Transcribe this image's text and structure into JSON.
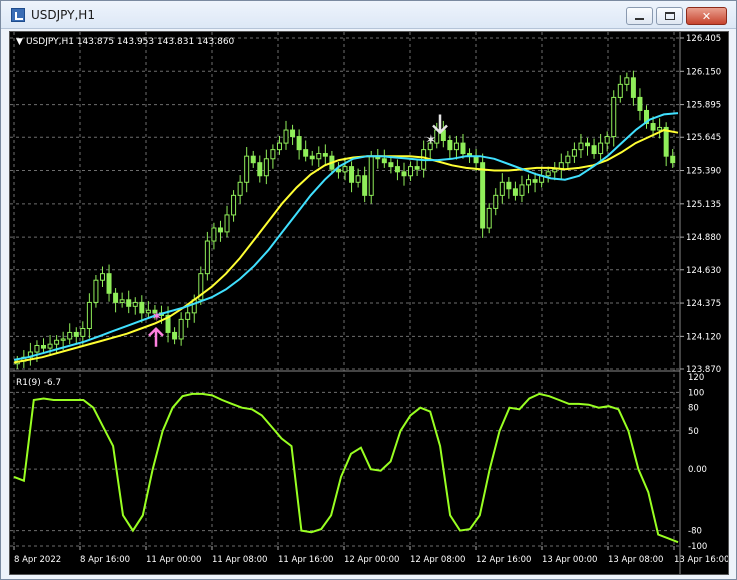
{
  "window": {
    "title": "USDJPY,H1",
    "minimize_label": "",
    "maximize_label": "",
    "close_label": "✕"
  },
  "price_panel": {
    "header": "USDJPY,H1  143.875 143.953 143.831 143.860",
    "header_arrow": "▼",
    "price_ticks": [
      "126.405",
      "126.150",
      "125.895",
      "125.645",
      "125.390",
      "125.135",
      "124.880",
      "124.630",
      "124.375",
      "124.120",
      "123.870"
    ]
  },
  "indicator_panel": {
    "label": "R1(9) -6.7",
    "ticks": [
      "120",
      "100",
      "80",
      "50",
      "0.00",
      "-80",
      "-100"
    ]
  },
  "time_axis": [
    "8 Apr 2022",
    "8 Apr 16:00",
    "11 Apr 00:00",
    "11 Apr 08:00",
    "11 Apr 16:00",
    "12 Apr 00:00",
    "12 Apr 08:00",
    "12 Apr 16:00",
    "13 Apr 00:00",
    "13 Apr 08:00",
    "13 Apr 16:00"
  ],
  "colors": {
    "background": "#000000",
    "grid": "#6e6e6e",
    "candle": "#90ee5a",
    "ma_fast": "#40e0ff",
    "ma_slow": "#ffff33",
    "oscillator": "#99ff22",
    "buy_arrow": "#ff80e0",
    "sell_arrow": "#e6e6e6"
  },
  "chart_data": {
    "type": "line",
    "symbol": "USDJPY",
    "timeframe": "H1",
    "ylim": [
      123.87,
      126.405
    ],
    "candles_close": [
      123.93,
      123.96,
      124.0,
      124.05,
      124.03,
      124.06,
      124.09,
      124.1,
      124.15,
      124.12,
      124.18,
      124.38,
      124.55,
      124.6,
      124.45,
      124.38,
      124.4,
      124.35,
      124.38,
      124.3,
      124.32,
      124.3,
      124.28,
      124.15,
      124.1,
      124.25,
      124.3,
      124.4,
      124.6,
      124.85,
      124.95,
      124.92,
      125.05,
      125.2,
      125.3,
      125.5,
      125.45,
      125.35,
      125.48,
      125.55,
      125.6,
      125.7,
      125.65,
      125.55,
      125.5,
      125.48,
      125.52,
      125.5,
      125.4,
      125.38,
      125.42,
      125.3,
      125.35,
      125.2,
      125.5,
      125.48,
      125.45,
      125.42,
      125.38,
      125.35,
      125.42,
      125.4,
      125.55,
      125.6,
      125.7,
      125.62,
      125.55,
      125.6,
      125.52,
      125.5,
      125.45,
      124.95,
      125.1,
      125.2,
      125.3,
      125.25,
      125.2,
      125.28,
      125.32,
      125.3,
      125.35,
      125.38,
      125.4,
      125.45,
      125.5,
      125.55,
      125.6,
      125.58,
      125.52,
      125.6,
      125.65,
      125.95,
      126.05,
      126.1,
      125.95,
      125.85,
      125.75,
      125.7,
      125.72,
      125.5,
      125.45
    ],
    "ma_fast": [
      123.94,
      123.96,
      123.99,
      124.02,
      124.05,
      124.08,
      124.12,
      124.16,
      124.2,
      124.24,
      124.28,
      124.31,
      124.34,
      124.38,
      124.42,
      124.48,
      124.56,
      124.66,
      124.78,
      124.92,
      125.06,
      125.2,
      125.32,
      125.42,
      125.48,
      125.5,
      125.5,
      125.49,
      125.48,
      125.47,
      125.47,
      125.48,
      125.5,
      125.5,
      125.48,
      125.44,
      125.4,
      125.36,
      125.33,
      125.32,
      125.35,
      125.42,
      125.5,
      125.6,
      125.7,
      125.78,
      125.82,
      125.83
    ],
    "ma_slow": [
      123.92,
      123.94,
      123.96,
      123.99,
      124.02,
      124.05,
      124.08,
      124.11,
      124.14,
      124.18,
      124.22,
      124.27,
      124.34,
      124.42,
      124.5,
      124.6,
      124.72,
      124.86,
      125.0,
      125.14,
      125.26,
      125.36,
      125.43,
      125.47,
      125.49,
      125.5,
      125.5,
      125.5,
      125.5,
      125.49,
      125.46,
      125.43,
      125.41,
      125.4,
      125.39,
      125.39,
      125.4,
      125.41,
      125.41,
      125.4,
      125.41,
      125.43,
      125.47,
      125.53,
      125.6,
      125.65,
      125.7,
      125.68
    ],
    "oscillator": [
      -10,
      -15,
      90,
      92,
      90,
      90,
      90,
      90,
      80,
      55,
      30,
      -60,
      -80,
      -60,
      0,
      50,
      80,
      95,
      98,
      98,
      96,
      90,
      85,
      80,
      78,
      70,
      55,
      40,
      30,
      -80,
      -82,
      -78,
      -60,
      -10,
      20,
      28,
      0,
      -2,
      10,
      50,
      70,
      80,
      75,
      30,
      -60,
      -80,
      -78,
      -60,
      0,
      50,
      80,
      78,
      92,
      98,
      95,
      90,
      85,
      85,
      84,
      80,
      82,
      78,
      50,
      0,
      -30,
      -85,
      -90,
      -95
    ],
    "osc_ylim": [
      -100,
      120
    ],
    "signals": [
      {
        "type": "buy",
        "x_label": "11 Apr 00:00",
        "price": 124.27
      },
      {
        "type": "sell",
        "x_label": "12 Apr 08:00",
        "price": 125.62
      }
    ]
  }
}
